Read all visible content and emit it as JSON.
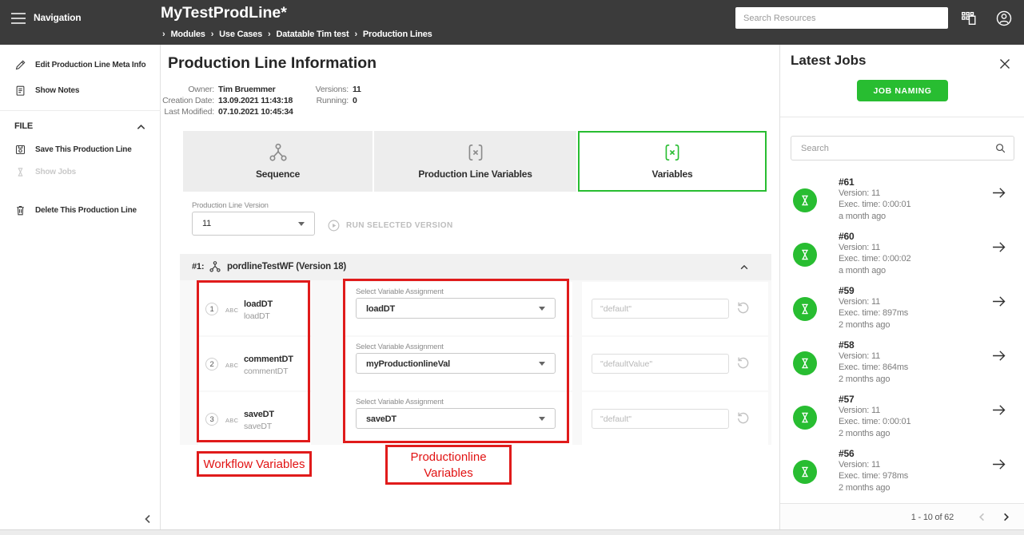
{
  "header": {
    "nav_label": "Navigation",
    "title": "MyTestProdLine*",
    "crumb_sep": "›",
    "breadcrumbs": [
      "Modules",
      "Use Cases",
      "Datatable Tim test",
      "Production Lines"
    ],
    "search_placeholder": "Search Resources"
  },
  "sidebar": {
    "edit_meta_label": "Edit Production Line Meta Info",
    "show_notes_label": "Show Notes",
    "file_section_title": "FILE",
    "save_label": "Save This Production Line",
    "show_jobs_label": "Show Jobs",
    "delete_label": "Delete This Production Line"
  },
  "main": {
    "page_title": "Production Line Information",
    "meta": {
      "owner_label": "Owner:",
      "owner_value": "Tim Bruemmer",
      "creation_label": "Creation Date:",
      "creation_value": "13.09.2021 11:43:18",
      "modified_label": "Last Modified:",
      "modified_value": "07.10.2021 10:45:34",
      "versions_label": "Versions:",
      "versions_value": "11",
      "running_label": "Running:",
      "running_value": "0"
    },
    "tabs": [
      {
        "label": "Sequence"
      },
      {
        "label": "Production Line Variables"
      },
      {
        "label": "Variables"
      }
    ],
    "version_label": "Production Line Version",
    "version_value": "11",
    "run_button_label": "RUN SELECTED VERSION",
    "workflow_panel": {
      "index": "#1:",
      "title": "pordlineTestWF (Version 18)",
      "rows": [
        {
          "num": "1",
          "type": "ABC",
          "name": "loadDT",
          "subname": "loadDT",
          "select_label": "Select Variable Assignment",
          "select_value": "loadDT",
          "placeholder": "\"default\""
        },
        {
          "num": "2",
          "type": "ABC",
          "name": "commentDT",
          "subname": "commentDT",
          "select_label": "Select Variable Assignment",
          "select_value": "myProductionlineVal",
          "placeholder": "\"defaultValue\""
        },
        {
          "num": "3",
          "type": "ABC",
          "name": "saveDT",
          "subname": "saveDT",
          "select_label": "Select Variable Assignment",
          "select_value": "saveDT",
          "placeholder": "\"default\""
        }
      ]
    },
    "annotations": {
      "workflow_label": "Workflow Variables",
      "productionline_label_line1": "Productionline",
      "productionline_label_line2": "Variables"
    }
  },
  "jobs_panel": {
    "title": "Latest Jobs",
    "job_naming_button": "JOB NAMING",
    "search_placeholder": "Search",
    "jobs": [
      {
        "id": "#61",
        "version": "Version: 11",
        "exec_time": "Exec. time: 0:00:01",
        "age": "a month ago"
      },
      {
        "id": "#60",
        "version": "Version: 11",
        "exec_time": "Exec. time: 0:00:02",
        "age": "a month ago"
      },
      {
        "id": "#59",
        "version": "Version: 11",
        "exec_time": "Exec. time: 897ms",
        "age": "2 months ago"
      },
      {
        "id": "#58",
        "version": "Version: 11",
        "exec_time": "Exec. time: 864ms",
        "age": "2 months ago"
      },
      {
        "id": "#57",
        "version": "Version: 11",
        "exec_time": "Exec. time: 0:00:01",
        "age": "2 months ago"
      },
      {
        "id": "#56",
        "version": "Version: 11",
        "exec_time": "Exec. time: 978ms",
        "age": "2 months ago"
      }
    ],
    "pagination_label": "1 - 10 of 62"
  },
  "colors": {
    "accent_green": "#28bd31",
    "header_bg": "#3b3b3b",
    "annotation_red": "#e01b1b"
  },
  "icons": [
    "hamburger-menu-icon",
    "modules-grid-icon",
    "account-icon",
    "pencil-icon",
    "notes-icon",
    "chevron-up-icon",
    "save-icon",
    "hourglass-icon",
    "trash-icon",
    "collapse-sidebar-icon",
    "workflow-icon",
    "variable-brackets-icon",
    "play-circle-icon",
    "select-caret-icon",
    "undo-icon",
    "close-icon",
    "search-icon",
    "job-status-icon",
    "arrow-right-icon",
    "chevron-left-icon",
    "chevron-right-icon"
  ]
}
